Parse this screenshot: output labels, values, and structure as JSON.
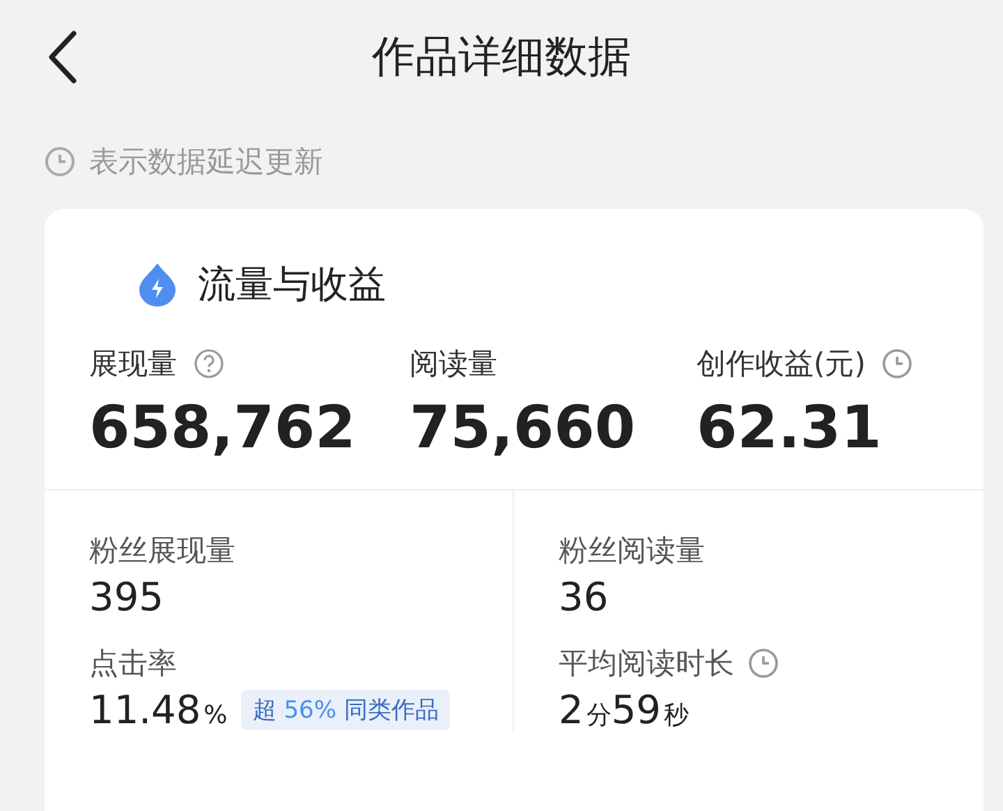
{
  "header": {
    "title": "作品详细数据"
  },
  "notice": {
    "text": "表示数据延迟更新"
  },
  "card": {
    "title": "流量与收益",
    "metrics": [
      {
        "label": "展现量",
        "value": "658,762",
        "kind": "help"
      },
      {
        "label": "阅读量",
        "value": "75,660",
        "kind": "plain"
      },
      {
        "label": "创作收益(元)",
        "value": "62.31",
        "kind": "delayed"
      }
    ],
    "fan_stats": [
      {
        "label": "粉丝展现量",
        "kind": "plain",
        "parts": [
          {
            "text": "395",
            "kind": "number"
          }
        ]
      },
      {
        "label": "粉丝阅读量",
        "kind": "plain",
        "parts": [
          {
            "text": "36",
            "kind": "number"
          }
        ]
      },
      {
        "label": "点击率",
        "kind": "plain",
        "parts": [
          {
            "text": "11.48",
            "kind": "number"
          },
          {
            "text": "%",
            "kind": "unit"
          }
        ],
        "badge": {
          "prefix": "超",
          "highlight": "56%",
          "suffix": "同类作品"
        }
      },
      {
        "label": "平均阅读时长",
        "kind": "delayed",
        "parts": [
          {
            "text": "2",
            "kind": "number"
          },
          {
            "text": "分",
            "kind": "unit"
          },
          {
            "text": "59",
            "kind": "number"
          },
          {
            "text": "秒",
            "kind": "unit"
          }
        ]
      }
    ]
  }
}
